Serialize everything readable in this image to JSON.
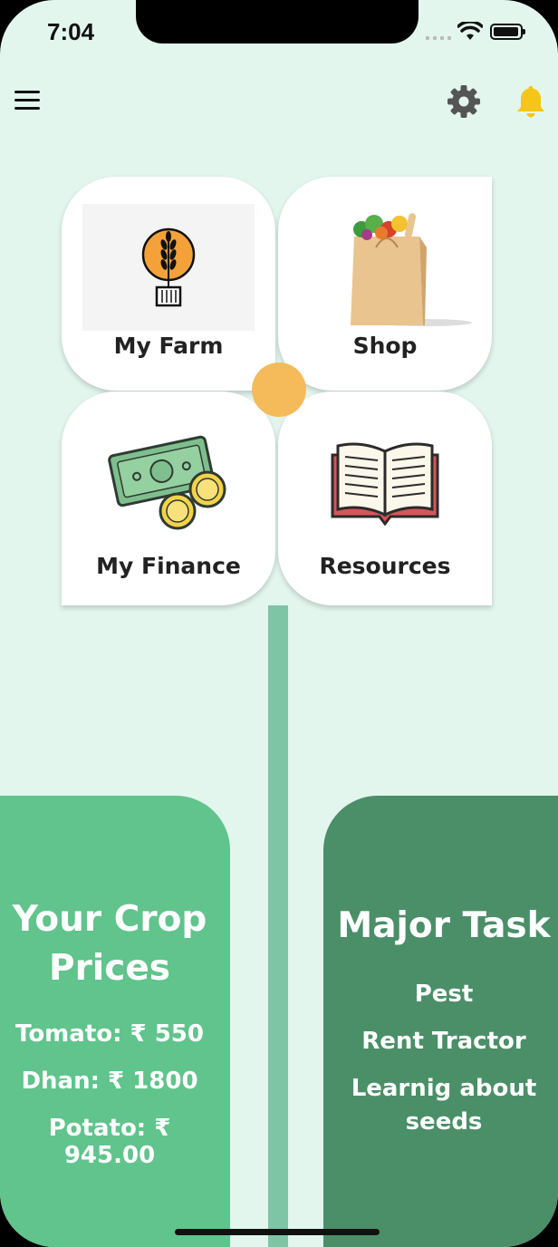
{
  "status_bar": {
    "time": "7:04"
  },
  "tiles": [
    {
      "label": "My Farm",
      "icon": "wheat-farm-icon"
    },
    {
      "label": "Shop",
      "icon": "grocery-bag-icon"
    },
    {
      "label": "My Finance",
      "icon": "money-coins-icon"
    },
    {
      "label": "Resources",
      "icon": "open-book-icon"
    }
  ],
  "crop_prices": {
    "title_line1": "Your Crop",
    "title_line2": "Prices",
    "items": [
      "Tomato: ₹ 550",
      "Dhan: ₹ 1800",
      "Potato: ₹ 945.00"
    ]
  },
  "major_task": {
    "title": "Major Task",
    "items": [
      "Pest",
      "Rent Tractor",
      "Learnig about",
      "seeds"
    ]
  },
  "colors": {
    "background": "#e2f6ee",
    "accent_orange": "#f5bb5a",
    "prices_card": "#60c48c",
    "task_card": "#4a8f68",
    "bell": "#f5c518"
  }
}
